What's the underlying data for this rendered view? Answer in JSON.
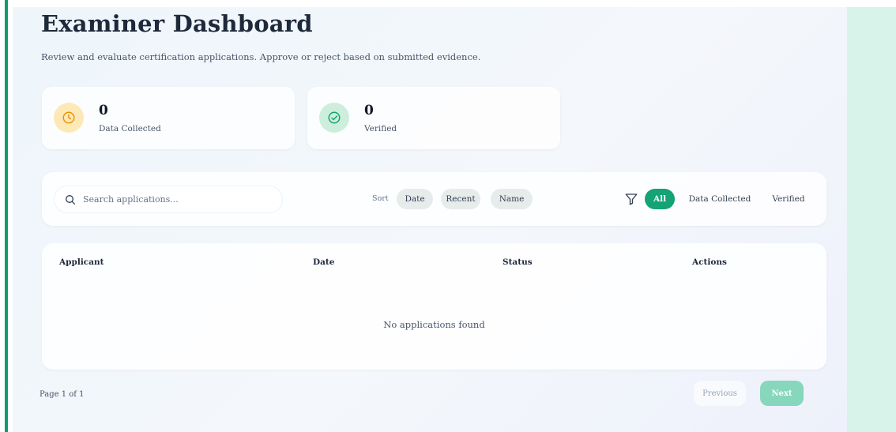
{
  "header": {
    "title": "Examiner Dashboard",
    "subtitle": "Review and evaluate certification applications. Approve or reject based on submitted evidence."
  },
  "stats": [
    {
      "count": "0",
      "label": "Data Collected",
      "icon": "clock-icon",
      "color": "#f59e0b"
    },
    {
      "count": "0",
      "label": "Verified",
      "icon": "check-circle-icon",
      "color": "#10b981"
    }
  ],
  "search": {
    "placeholder": "Search applications..."
  },
  "sort": {
    "label": "Sort",
    "options": [
      "Date",
      "Recent",
      "Name"
    ]
  },
  "filter": {
    "icon": "filter-icon",
    "options": [
      "All",
      "Data Collected",
      "Verified"
    ],
    "selected": "All"
  },
  "table": {
    "columns": [
      "Applicant",
      "Date",
      "Status",
      "Actions"
    ],
    "empty_message": "No applications found"
  },
  "pagination": {
    "info": "Page 1 of 1",
    "previous_label": "Previous",
    "next_label": "Next"
  },
  "colors": {
    "accent": "#13a374",
    "accent_light": "#86d7bb",
    "amber_bg": "#fde9b6",
    "green_bg": "#cdeedd",
    "side_panel": "#d7f3ea"
  }
}
